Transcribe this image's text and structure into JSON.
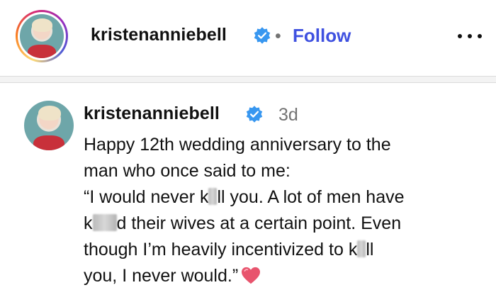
{
  "header": {
    "username": "kristenanniebell",
    "separator": "•",
    "follow_label": "Follow"
  },
  "post": {
    "username": "kristenanniebell",
    "time_ago": "3d",
    "caption_lines": {
      "l1": "Happy 12th wedding anniversary to the",
      "l2": "man who once said to me:",
      "l3a": "“I would never k",
      "l3b": "ll you. A lot of men have",
      "l4a": "k",
      "l4b": "d their wives at a certain point. Even",
      "l5a": "though I’m heavily incentivized to k",
      "l5b": "ll",
      "l6": "you, I never would.”"
    }
  },
  "colors": {
    "follow": "#3f51e0",
    "verified": "#3897f0",
    "heart": "#e8546d",
    "muted": "#737373"
  },
  "icons": {
    "verified": "verified-badge-icon",
    "more": "more-options-icon",
    "heart": "pink-heart-emoji"
  }
}
